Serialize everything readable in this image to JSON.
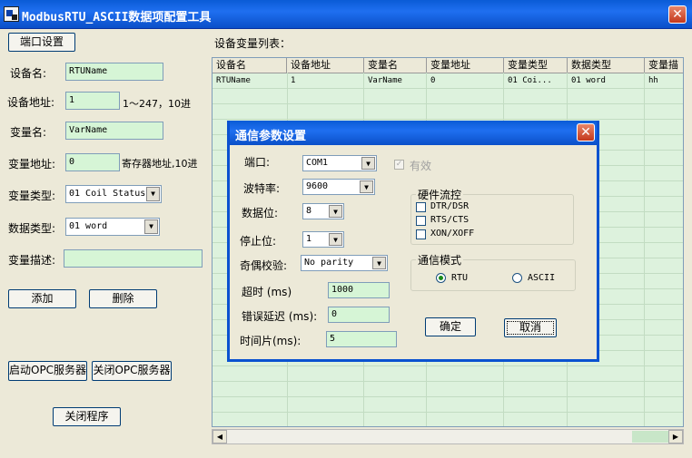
{
  "window": {
    "title": "ModbusRTU_ASCII数据项配置工具",
    "close_glyph": "✕"
  },
  "left_panel": {
    "port_settings_button": "端口设置",
    "device_name_label": "设备名:",
    "device_name_value": "RTUName",
    "device_address_label": "设备地址:",
    "device_address_value": "1",
    "device_address_hint": "1～247，10进",
    "var_name_label": "变量名:",
    "var_name_value": "VarName",
    "var_address_label": "变量地址:",
    "var_address_value": "0",
    "var_address_hint": "寄存器地址,10进",
    "var_type_label": "变量类型:",
    "var_type_value": "01 Coil Status",
    "data_type_label": "数据类型:",
    "data_type_value": "01 word",
    "var_desc_label": "变量描述:",
    "var_desc_value": "",
    "add_button": "添加",
    "delete_button": "删除",
    "start_opc_button": "启动OPC服务器",
    "stop_opc_button": "关闭OPC服务器",
    "close_program_button": "关闭程序"
  },
  "list": {
    "title": "设备变量列表：",
    "columns": [
      "设备名",
      "设备地址",
      "变量名",
      "变量地址",
      "变量类型",
      "数据类型",
      "变量描"
    ],
    "rows": [
      [
        "RTUName",
        "1",
        "VarName",
        "0",
        "01 Coi...",
        "01 word",
        "hh"
      ]
    ]
  },
  "dialog": {
    "title": "通信参数设置",
    "close_glyph": "✕",
    "port_label": "端口:",
    "port_value": "COM1",
    "valid_label": "有效",
    "valid_checked": true,
    "baud_label": "波特率:",
    "baud_value": "9600",
    "databits_label": "数据位:",
    "databits_value": "8",
    "stopbits_label": "停止位:",
    "stopbits_value": "1",
    "parity_label": "奇偶校验:",
    "parity_value": "No parity",
    "timeout_label": "超时 (ms)",
    "timeout_value": "1000",
    "err_delay_label": "错误延迟 (ms):",
    "err_delay_value": "0",
    "timeslice_label": "时间片(ms):",
    "timeslice_value": "5",
    "flow_control": {
      "legend": "硬件流控",
      "items": [
        "DTR/DSR",
        "RTS/CTS",
        "XON/XOFF"
      ]
    },
    "mode": {
      "legend": "通信模式",
      "options": [
        "RTU",
        "ASCII"
      ],
      "selected": "RTU"
    },
    "ok_button": "确定",
    "cancel_button": "取消"
  }
}
